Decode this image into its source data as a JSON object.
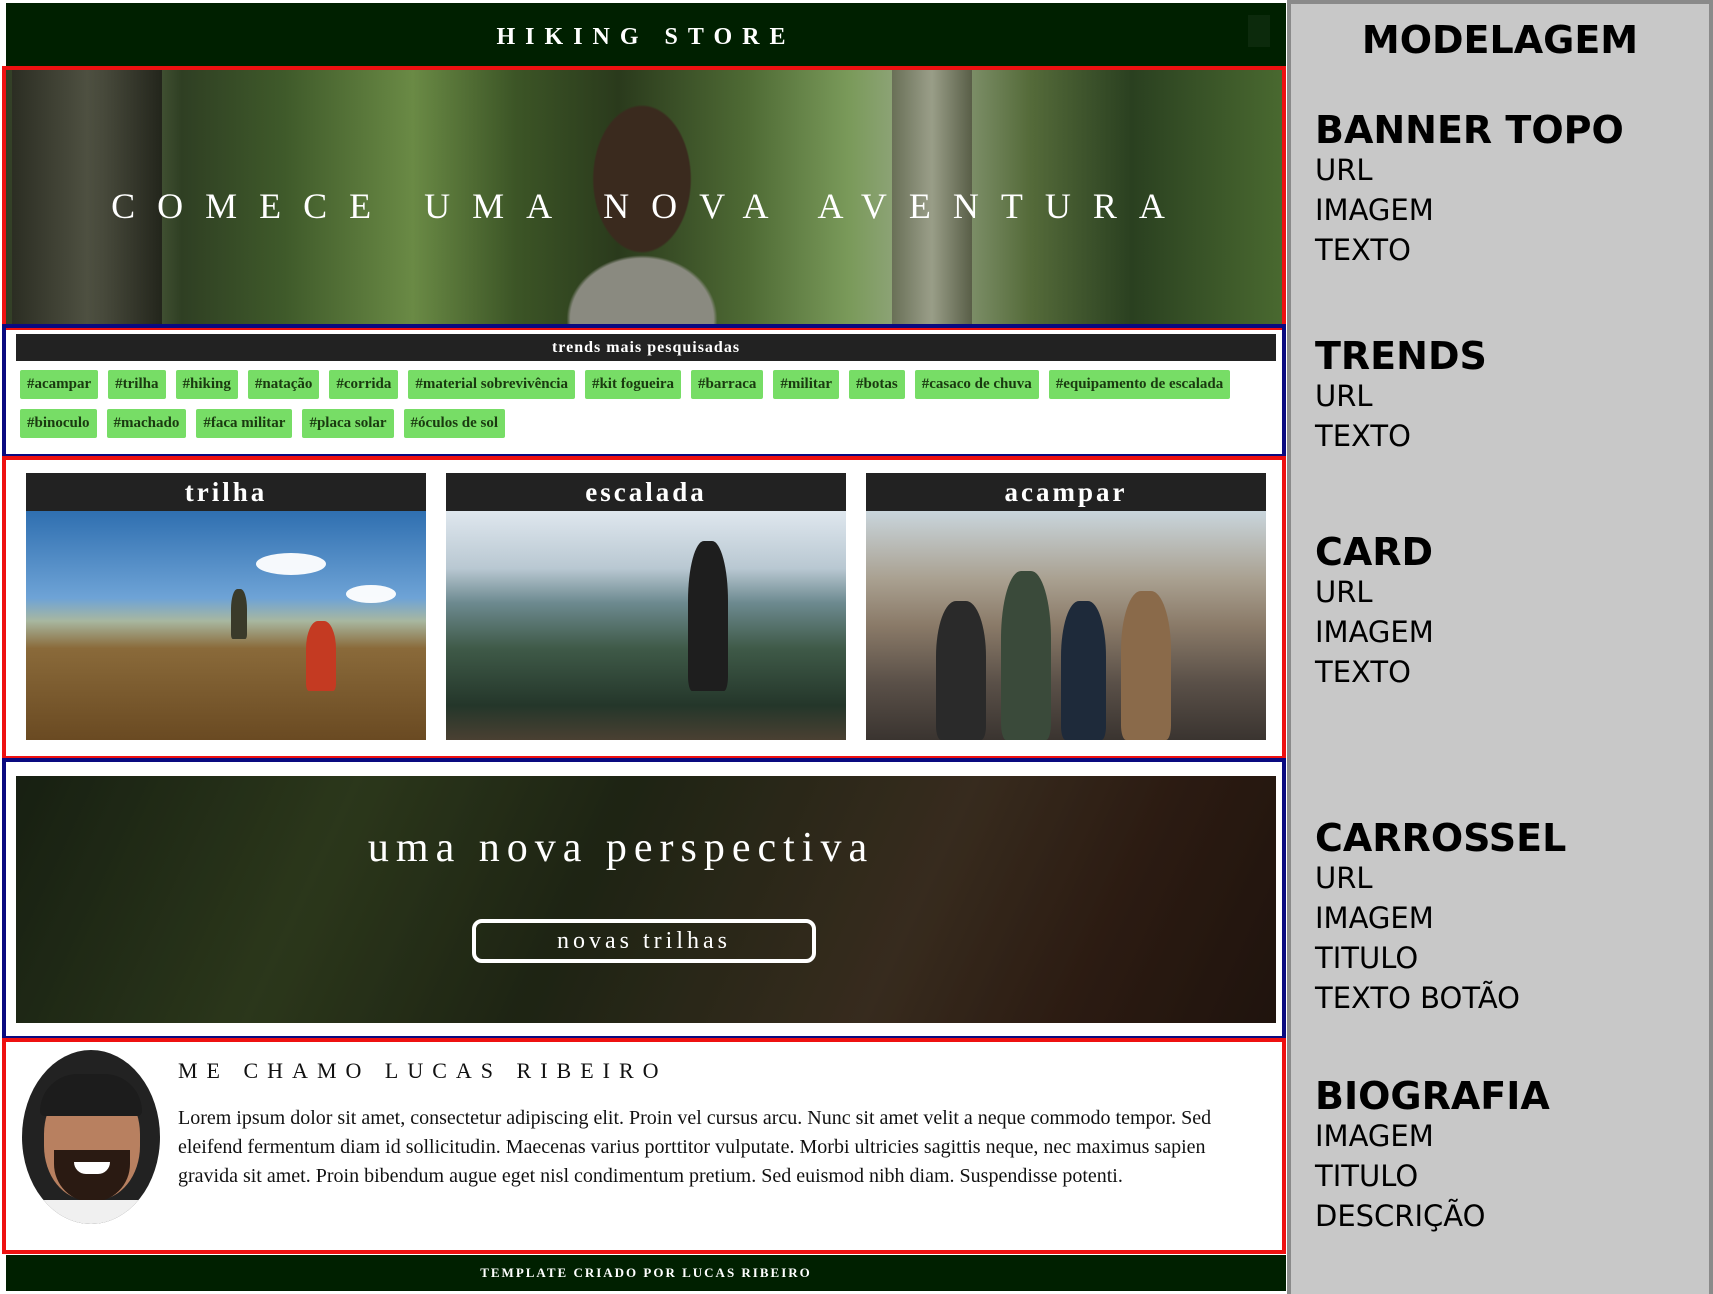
{
  "header": {
    "title": "HIKING STORE"
  },
  "banner": {
    "text": "COMECE UMA NOVA AVENTURA"
  },
  "trends": {
    "title": "trends mais pesquisadas",
    "tags": [
      "#acampar",
      "#trilha",
      "#hiking",
      "#natação",
      "#corrida",
      "#material sobrevivência",
      "#kit fogueira",
      "#barraca",
      "#militar",
      "#botas",
      "#casaco de chuva",
      "#equipamento de escalada",
      "#binoculo",
      "#machado",
      "#faca militar",
      "#placa solar",
      "#óculos de sol"
    ]
  },
  "cards": [
    {
      "title": "trilha"
    },
    {
      "title": "escalada"
    },
    {
      "title": "acampar"
    }
  ],
  "carousel": {
    "title": "uma nova perspectiva",
    "button": "novas trilhas"
  },
  "bio": {
    "title": "ME CHAMO LUCAS RIBEIRO",
    "text": "Lorem ipsum dolor sit amet, consectetur adipiscing elit. Proin vel cursus arcu. Nunc sit amet velit a neque commodo tempor. Sed eleifend fermentum diam id sollicitudin. Maecenas varius porttitor vulputate. Morbi ultricies sagittis neque, nec maximus sapien gravida sit amet. Proin bibendum augue eget nisl condimentum pretium. Sed euismod nibh diam. Suspendisse potenti."
  },
  "footer": {
    "text": "TEMPLATE CRIADO POR LUCAS RIBEIRO"
  },
  "panel": {
    "title": "MODELAGEM",
    "sections": [
      {
        "head": "BANNER TOPO",
        "fields": [
          "URL",
          "IMAGEM",
          "TEXTO"
        ]
      },
      {
        "head": "TRENDS",
        "fields": [
          "URL",
          "TEXTO"
        ]
      },
      {
        "head": "CARD",
        "fields": [
          "URL",
          "IMAGEM",
          "TEXTO"
        ]
      },
      {
        "head": "CARROSSEL",
        "fields": [
          "URL",
          "IMAGEM",
          "TITULO",
          "TEXTO BOTÃO"
        ]
      },
      {
        "head": "BIOGRAFIA",
        "fields": [
          "IMAGEM",
          "TITULO",
          "DESCRIÇÃO"
        ]
      }
    ]
  },
  "colors": {
    "header_bg": "#002000",
    "tag_bg": "#77dd66",
    "outline_red": "#ee1111",
    "outline_blue": "#0a0a80",
    "panel_bg": "#c8c8c8"
  }
}
